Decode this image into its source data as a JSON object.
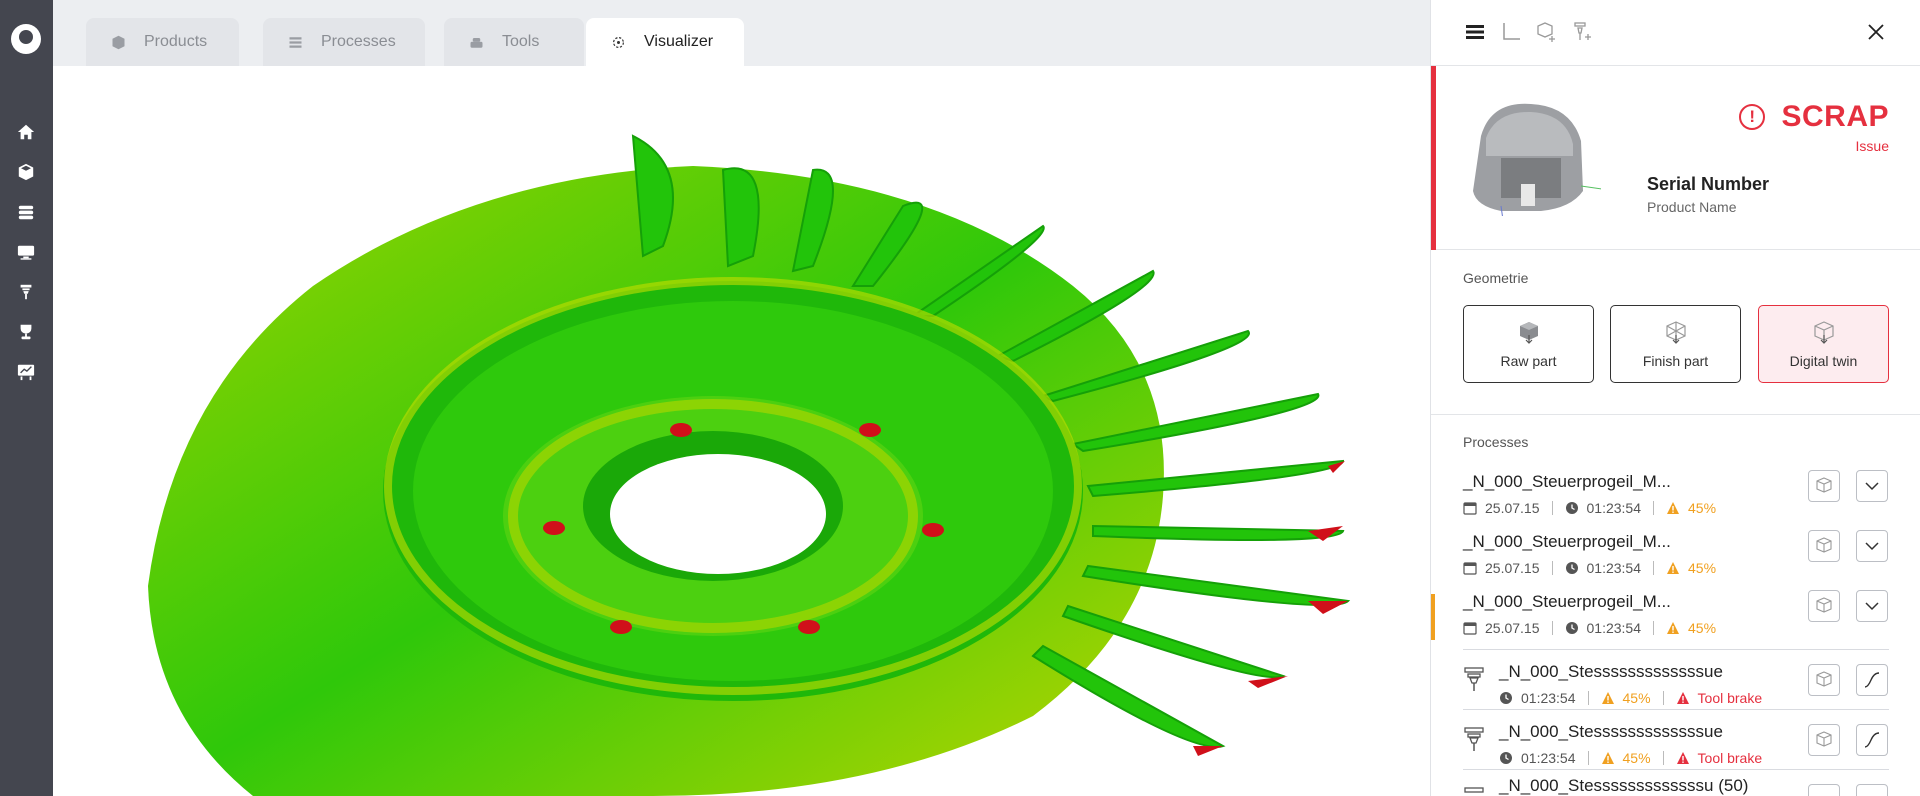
{
  "tabs": [
    {
      "label": "Products",
      "icon": "cube-icon"
    },
    {
      "label": "Processes",
      "icon": "list-icon"
    },
    {
      "label": "Tools",
      "icon": "stack-icon"
    },
    {
      "label": "Visualizer",
      "icon": "target-icon",
      "active": true
    }
  ],
  "sidebar": {
    "items": [
      "home-icon",
      "cube-icon",
      "layers-icon",
      "monitor-icon",
      "tool-icon",
      "trophy-icon",
      "chart-icon"
    ]
  },
  "viewer": {
    "model": "turbine-impeller-3d",
    "colors": {
      "surface": "#22c40a",
      "highlight": "#c8d800",
      "defect": "#d0101a"
    }
  },
  "panel": {
    "toolbar_icons": [
      "layers-toolbar-icon",
      "axis-toolbar-icon",
      "add-part-icon",
      "add-tool-icon",
      "close-icon"
    ],
    "status": {
      "label": "SCRAP",
      "sub": "Issue",
      "color": "#e5303f"
    },
    "serial_number": "Serial Number",
    "product_name": "Product Name",
    "geometry": {
      "label": "Geometrie",
      "buttons": [
        {
          "label": "Raw part"
        },
        {
          "label": "Finish part"
        },
        {
          "label": "Digital twin",
          "active": true
        }
      ]
    },
    "processes": {
      "label": "Processes",
      "items": [
        {
          "title": "_N_000_Steuerprogeil_M...",
          "date": "25.07.15",
          "time": "01:23:54",
          "percent": "45%"
        },
        {
          "title": "_N_000_Steuerprogeil_M...",
          "date": "25.07.15",
          "time": "01:23:54",
          "percent": "45%"
        },
        {
          "title": "_N_000_Steuerprogeil_M...",
          "date": "25.07.15",
          "time": "01:23:54",
          "percent": "45%",
          "highlight": true
        }
      ],
      "tools": [
        {
          "title": "_N_000_Stesssssssssssssue",
          "time": "01:23:54",
          "percent": "45%",
          "error": "Tool brake"
        },
        {
          "title": "_N_000_Stesssssssssssssue",
          "time": "01:23:54",
          "percent": "45%",
          "error": "Tool brake"
        },
        {
          "title": "_N_000_Stesssssssssssssu (50)"
        }
      ]
    }
  }
}
